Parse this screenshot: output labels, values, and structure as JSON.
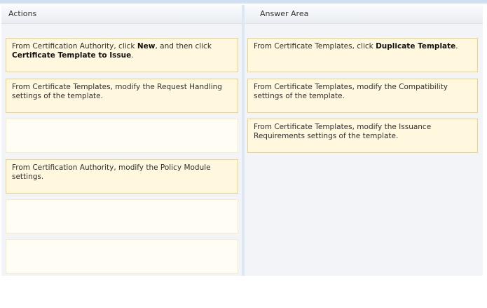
{
  "actions": {
    "title": "Actions",
    "items": [
      {
        "parts": [
          "From Certification Authority, click ",
          "New",
          ", and then click ",
          "Certificate Template to Issue",
          "."
        ]
      },
      {
        "text": "From Certificate Templates, modify the Request Handling settings of the template."
      },
      {
        "text": ""
      },
      {
        "text": "From Certification Authority, modify the Policy Module settings."
      },
      {
        "text": ""
      },
      {
        "text": ""
      }
    ]
  },
  "answer_area": {
    "title": "Answer Area",
    "items": [
      {
        "parts": [
          "From Certificate Templates, click ",
          "Duplicate Template",
          "."
        ]
      },
      {
        "text": "From Certificate Templates, modify the Compatibility settings of the template."
      },
      {
        "text": "From Certificate Templates, modify the Issuance Requirements settings of the template."
      }
    ]
  }
}
